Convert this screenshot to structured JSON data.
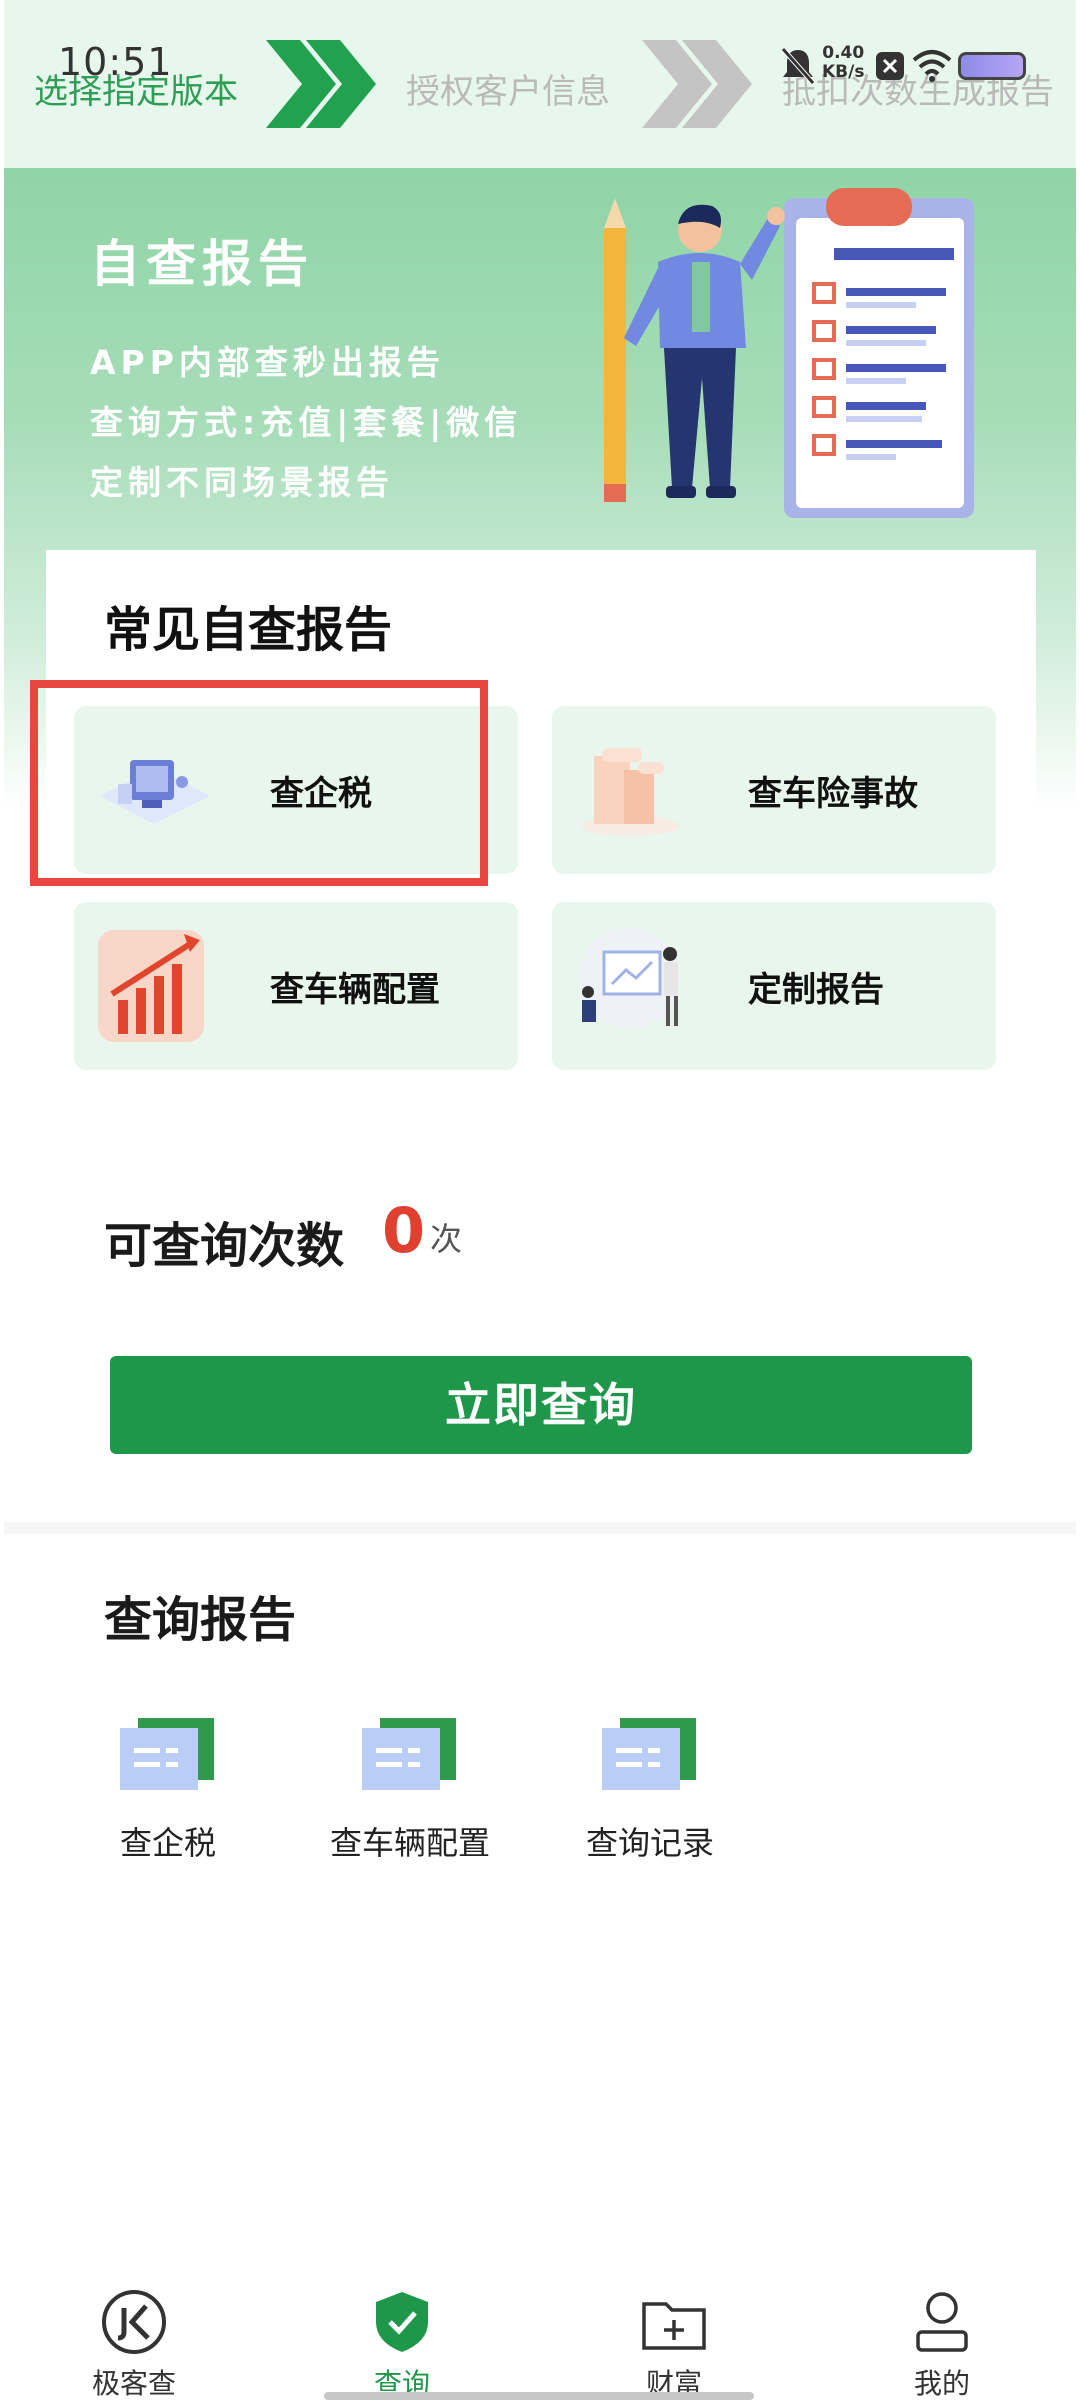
{
  "status_bar": {
    "time": "10:51",
    "net_speed": "0.40",
    "net_unit": "KB/s"
  },
  "steps": [
    {
      "label": "选择指定版本",
      "active": true
    },
    {
      "label": "授权客户信息",
      "active": false
    },
    {
      "label": "抵扣次数生成报告",
      "active": false
    }
  ],
  "hero": {
    "title": "自查报告",
    "lines": [
      "APP内部查秒出报告",
      "查询方式:充值|套餐|微信",
      "定制不同场景报告"
    ]
  },
  "common_reports": {
    "title": "常见自查报告",
    "tiles": [
      {
        "label": "查企税",
        "icon": "enterprise-tax-illustration"
      },
      {
        "label": "查车险事故",
        "icon": "car-insurance-illustration"
      },
      {
        "label": "查车辆配置",
        "icon": "bar-chart-illustration"
      },
      {
        "label": "定制报告",
        "icon": "presentation-illustration"
      }
    ]
  },
  "query_count": {
    "label": "可查询次数",
    "value": "0",
    "unit": "次"
  },
  "query_button": {
    "label": "立即查询"
  },
  "query_reports": {
    "title": "查询报告",
    "items": [
      {
        "label": "查企税",
        "icon": "report-card-icon"
      },
      {
        "label": "查车辆配置",
        "icon": "report-card-icon"
      },
      {
        "label": "查询记录",
        "icon": "report-card-icon"
      }
    ]
  },
  "bottom_nav": [
    {
      "label": "极客查",
      "icon": "jk-logo-icon",
      "active": false
    },
    {
      "label": "查询",
      "icon": "shield-check-icon",
      "active": true
    },
    {
      "label": "财富",
      "icon": "folder-plus-icon",
      "active": false
    },
    {
      "label": "我的",
      "icon": "user-icon",
      "active": false
    }
  ],
  "colors": {
    "brand_green": "#1e974b",
    "highlight_red": "#e8463f",
    "count_red": "#e0402f"
  }
}
